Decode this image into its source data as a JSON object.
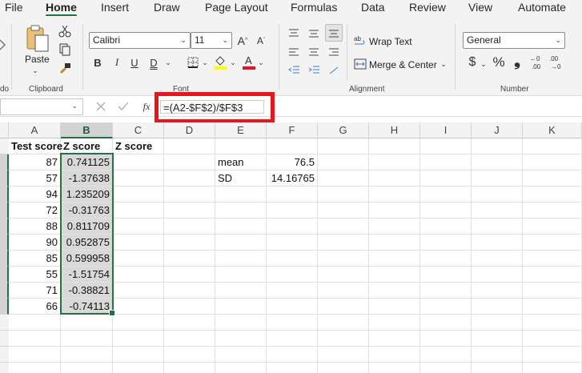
{
  "menu": {
    "tabs": [
      "File",
      "Home",
      "Insert",
      "Draw",
      "Page Layout",
      "Formulas",
      "Data",
      "Review",
      "View",
      "Automate"
    ],
    "active": "Home"
  },
  "ribbon": {
    "clipboard": {
      "paste_label": "Paste",
      "group_label": "Clipboard",
      "cut_partial": "do"
    },
    "font": {
      "font_name": "Calibri",
      "font_size": "11",
      "bold": "B",
      "italic": "I",
      "underline": "U",
      "double_underline": "D",
      "group_label": "Font",
      "highlight_color": "#ffff00",
      "font_color": "#e81123"
    },
    "alignment": {
      "wrap_text": "Wrap Text",
      "merge_center": "Merge & Center",
      "group_label": "Alignment"
    },
    "number": {
      "format": "General",
      "currency": "$",
      "percent": "%",
      "comma": "❟",
      "group_label": "Number"
    }
  },
  "formula_bar": {
    "fx": "fx",
    "formula": "=(A2-$F$2)/$F$3",
    "highlight_color": "#e8151b"
  },
  "grid": {
    "columns": [
      "A",
      "B",
      "C",
      "D",
      "E",
      "F",
      "G",
      "H",
      "I",
      "J",
      "K"
    ],
    "selected_column": "B",
    "headers": {
      "a": "Test score",
      "b": "Z score",
      "c": "Z score"
    },
    "test_scores": [
      "87",
      "57",
      "94",
      "72",
      "88",
      "90",
      "85",
      "55",
      "71",
      "66"
    ],
    "z_scores": [
      "0.741125",
      "-1.37638",
      "1.235209",
      "-0.31763",
      "0.811709",
      "0.952875",
      "0.599958",
      "-1.51754",
      "-0.38821",
      "-0.74113"
    ],
    "stats": {
      "mean_label": "mean",
      "mean_value": "76.5",
      "sd_label": "SD",
      "sd_value": "14.16765"
    },
    "accent_color": "#217346"
  }
}
